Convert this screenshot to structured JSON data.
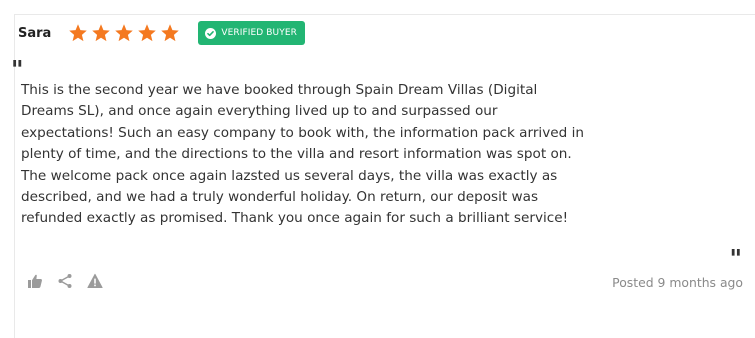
{
  "review": {
    "author": "Sara",
    "rating": 5,
    "rating_max": 5,
    "badge_label": "VERIFIED BUYER",
    "text_lines": [
      "This is the second year we have booked through Spain Dream Villas (Digital",
      "Dreams SL), and once again everything lived up to and surpassed our",
      "expectations! Such an easy company to book with, the information pack arrived in",
      "plenty of time, and the directions to the villa and resort information was spot on.",
      "The welcome pack once again lazsted us several days, the villa was exactly as",
      "described, and we had a truly wonderful holiday. On return, our deposit was",
      "refunded exactly as promised. Thank you once again for such a brilliant service!"
    ],
    "posted": "Posted 9 months ago"
  },
  "icons": {
    "star": "star-icon",
    "badge": "check-circle-icon",
    "like": "thumbs-up-icon",
    "share": "share-icon",
    "report": "warning-icon"
  },
  "colors": {
    "star": "#f47920",
    "badge_bg": "#22b573",
    "text": "#333333",
    "muted": "#8a8a8a",
    "icon": "#9b9b9b"
  }
}
